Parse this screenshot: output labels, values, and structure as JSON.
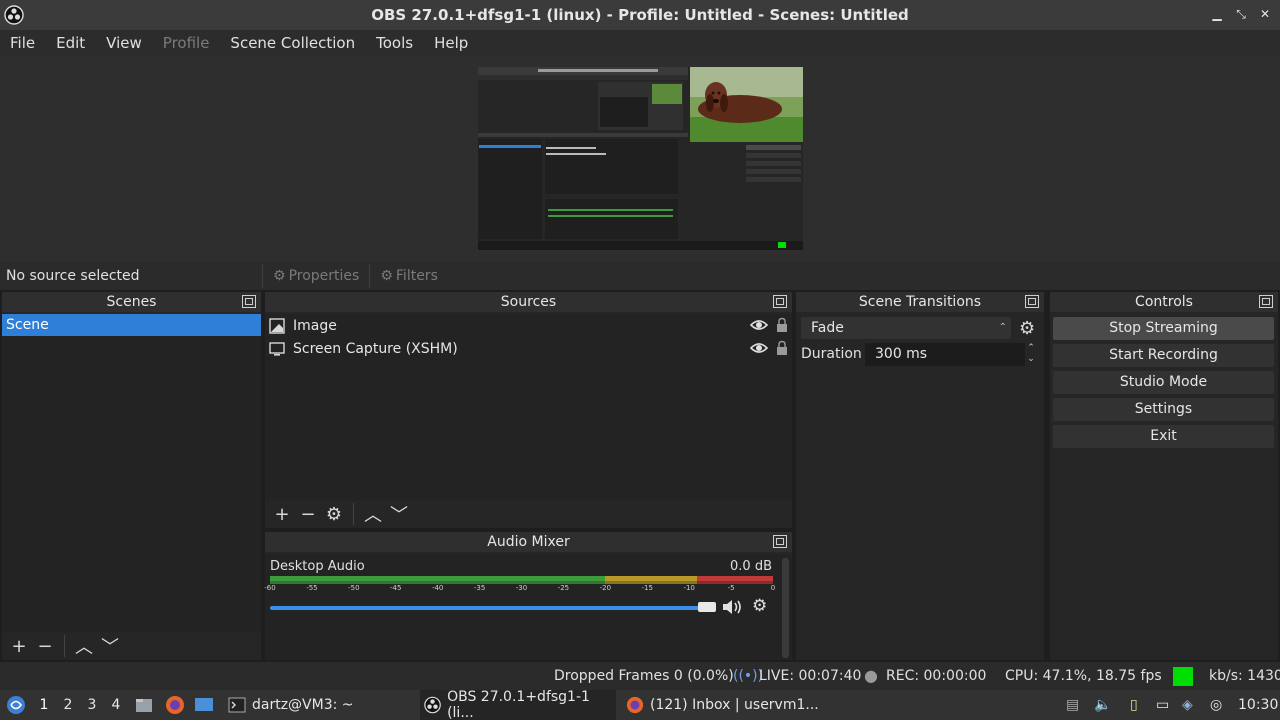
{
  "window": {
    "title": "OBS 27.0.1+dfsg1-1 (linux) - Profile: Untitled - Scenes: Untitled"
  },
  "menu": [
    {
      "label": "File",
      "enabled": true
    },
    {
      "label": "Edit",
      "enabled": true
    },
    {
      "label": "View",
      "enabled": true
    },
    {
      "label": "Profile",
      "enabled": false
    },
    {
      "label": "Scene Collection",
      "enabled": true
    },
    {
      "label": "Tools",
      "enabled": true
    },
    {
      "label": "Help",
      "enabled": true
    }
  ],
  "source_bar": {
    "no_source": "No source selected",
    "properties": "Properties",
    "filters": "Filters"
  },
  "scenes": {
    "title": "Scenes",
    "items": [
      "Scene"
    ]
  },
  "sources": {
    "title": "Sources",
    "items": [
      {
        "name": "Image",
        "icon": "image-icon"
      },
      {
        "name": "Screen Capture (XSHM)",
        "icon": "monitor-icon"
      }
    ]
  },
  "mixer": {
    "title": "Audio Mixer",
    "channel": "Desktop Audio",
    "level": "0.0 dB",
    "scale": [
      "-60",
      "-55",
      "-50",
      "-45",
      "-40",
      "-35",
      "-30",
      "-25",
      "-20",
      "-15",
      "-10",
      "-5",
      "0"
    ],
    "volume": 1.0
  },
  "transitions": {
    "title": "Scene Transitions",
    "selected": "Fade",
    "duration_label": "Duration",
    "duration_value": "300 ms"
  },
  "controls": {
    "title": "Controls",
    "buttons": [
      "Stop Streaming",
      "Start Recording",
      "Studio Mode",
      "Settings",
      "Exit"
    ]
  },
  "status": {
    "dropped": "Dropped Frames 0 (0.0%)",
    "live": "LIVE: 00:07:40",
    "rec": "REC: 00:00:00",
    "cpu": "CPU: 47.1%, 18.75 fps",
    "kbps": "kb/s: 1430",
    "indicator_color": "#00dd00"
  },
  "taskbar": {
    "workspaces": [
      "1",
      "2",
      "3",
      "4"
    ],
    "active_workspace": "1",
    "tasks": [
      {
        "label": "dartz@VM3: ~",
        "icon": "terminal-icon"
      },
      {
        "label": "OBS 27.0.1+dfsg1-1 (li...",
        "icon": "obs-icon"
      },
      {
        "label": "(121) Inbox | uservm1...",
        "icon": "firefox-icon"
      }
    ],
    "clock": "10:30"
  },
  "colors": {
    "accent": "#2f7fd9",
    "meter_green": "#3c9c3c",
    "meter_yellow": "#b89a28",
    "meter_red": "#c03a3a"
  }
}
